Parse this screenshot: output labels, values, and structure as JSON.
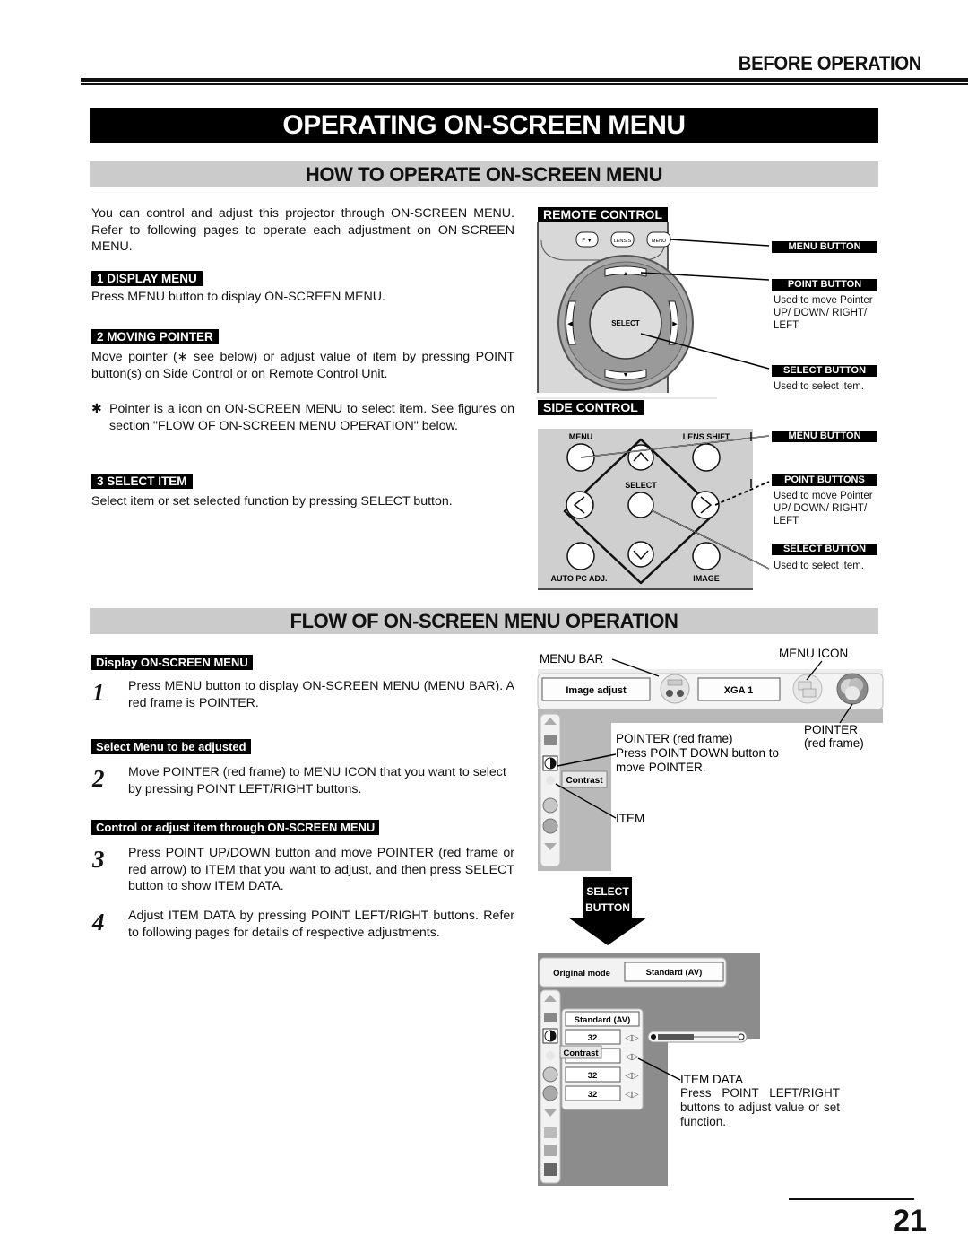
{
  "header": {
    "section": "BEFORE OPERATION",
    "title": "OPERATING ON-SCREEN MENU"
  },
  "how_to": {
    "heading": "HOW TO OPERATE ON-SCREEN MENU",
    "intro": "You can control and adjust this projector through ON-SCREEN MENU. Refer to following pages to operate each adjustment on ON-SCREEN MENU.",
    "steps": [
      {
        "label": "1  DISPLAY MENU",
        "text": "Press MENU button to display ON-SCREEN MENU."
      },
      {
        "label": "2  MOVING POINTER",
        "text": "Move pointer (∗ see below) or adjust value of item by pressing POINT button(s) on Side Control or on Remote Control Unit."
      },
      {
        "label": "3  SELECT ITEM",
        "text": "Select item or set selected function by pressing SELECT button."
      }
    ],
    "note_symbol": "✱",
    "note": "Pointer is a icon on ON-SCREEN MENU to select item. See figures on section \"FLOW OF ON-SCREEN MENU OPERATION\" below."
  },
  "remote_control": {
    "label": "REMOTE CONTROL",
    "buttons": {
      "focus": "F ▼",
      "lens": "LENS.S",
      "menu": "MENU",
      "select": "SELECT"
    },
    "callouts": [
      {
        "label": "MENU BUTTON",
        "desc": ""
      },
      {
        "label": "POINT BUTTON",
        "desc": "Used to move Pointer UP/ DOWN/ RIGHT/ LEFT."
      },
      {
        "label": "SELECT BUTTON",
        "desc": "Used to select item."
      }
    ]
  },
  "side_control": {
    "label": "SIDE CONTROL",
    "buttons": {
      "menu": "MENU",
      "lens_shift": "LENS SHIFT",
      "select": "SELECT",
      "auto_pc": "AUTO PC ADJ.",
      "image": "IMAGE"
    },
    "callouts": [
      {
        "label": "MENU BUTTON",
        "desc": ""
      },
      {
        "label": "POINT BUTTONS",
        "desc": "Used to move Pointer UP/ DOWN/ RIGHT/ LEFT."
      },
      {
        "label": "SELECT BUTTON",
        "desc": "Used to select item."
      }
    ]
  },
  "flow": {
    "heading": "FLOW OF ON-SCREEN MENU OPERATION",
    "sections": [
      {
        "label": "Display ON-SCREEN MENU",
        "num": "1",
        "text": "Press MENU button to display ON-SCREEN MENU (MENU BAR).  A red frame is POINTER."
      },
      {
        "label": "Select Menu to be adjusted",
        "num": "2",
        "text": "Move POINTER (red frame) to MENU ICON that you want to select by pressing POINT LEFT/RIGHT buttons."
      },
      {
        "label": "Control or adjust item through ON-SCREEN MENU",
        "num": "3",
        "text": "Press POINT UP/DOWN button and move POINTER (red frame or red arrow) to ITEM that you want to adjust, and then press SELECT button to show ITEM DATA."
      },
      {
        "label": "",
        "num": "4",
        "text": "Adjust ITEM DATA by pressing POINT LEFT/RIGHT buttons. Refer to following pages for details of respective adjustments."
      }
    ],
    "menu_diagram": {
      "menu_bar_label": "MENU BAR",
      "menu_icon_label": "MENU ICON",
      "pointer_right": "POINTER\n(red frame)",
      "pointer_left_1": "POINTER (red frame)",
      "pointer_left_2": "Press POINT DOWN button to",
      "pointer_left_3": "move POINTER.",
      "item_label": "ITEM",
      "menu_bar_field1": "Image adjust",
      "menu_bar_field2": "XGA 1",
      "tooltip": "Contrast"
    },
    "select_arrow": {
      "line1": "SELECT",
      "line2": "BUTTON"
    },
    "item_diagram": {
      "mode_label": "Original mode",
      "mode_value": "Standard (AV)",
      "list_header": "Standard (AV)",
      "values": [
        "32",
        "",
        "32",
        "32"
      ],
      "tooltip": "Contrast",
      "slider_fraction": 0.45,
      "item_data_label": "ITEM DATA",
      "item_data_desc": "Press POINT LEFT/RIGHT buttons to adjust value or set function."
    }
  },
  "page_number": "21"
}
